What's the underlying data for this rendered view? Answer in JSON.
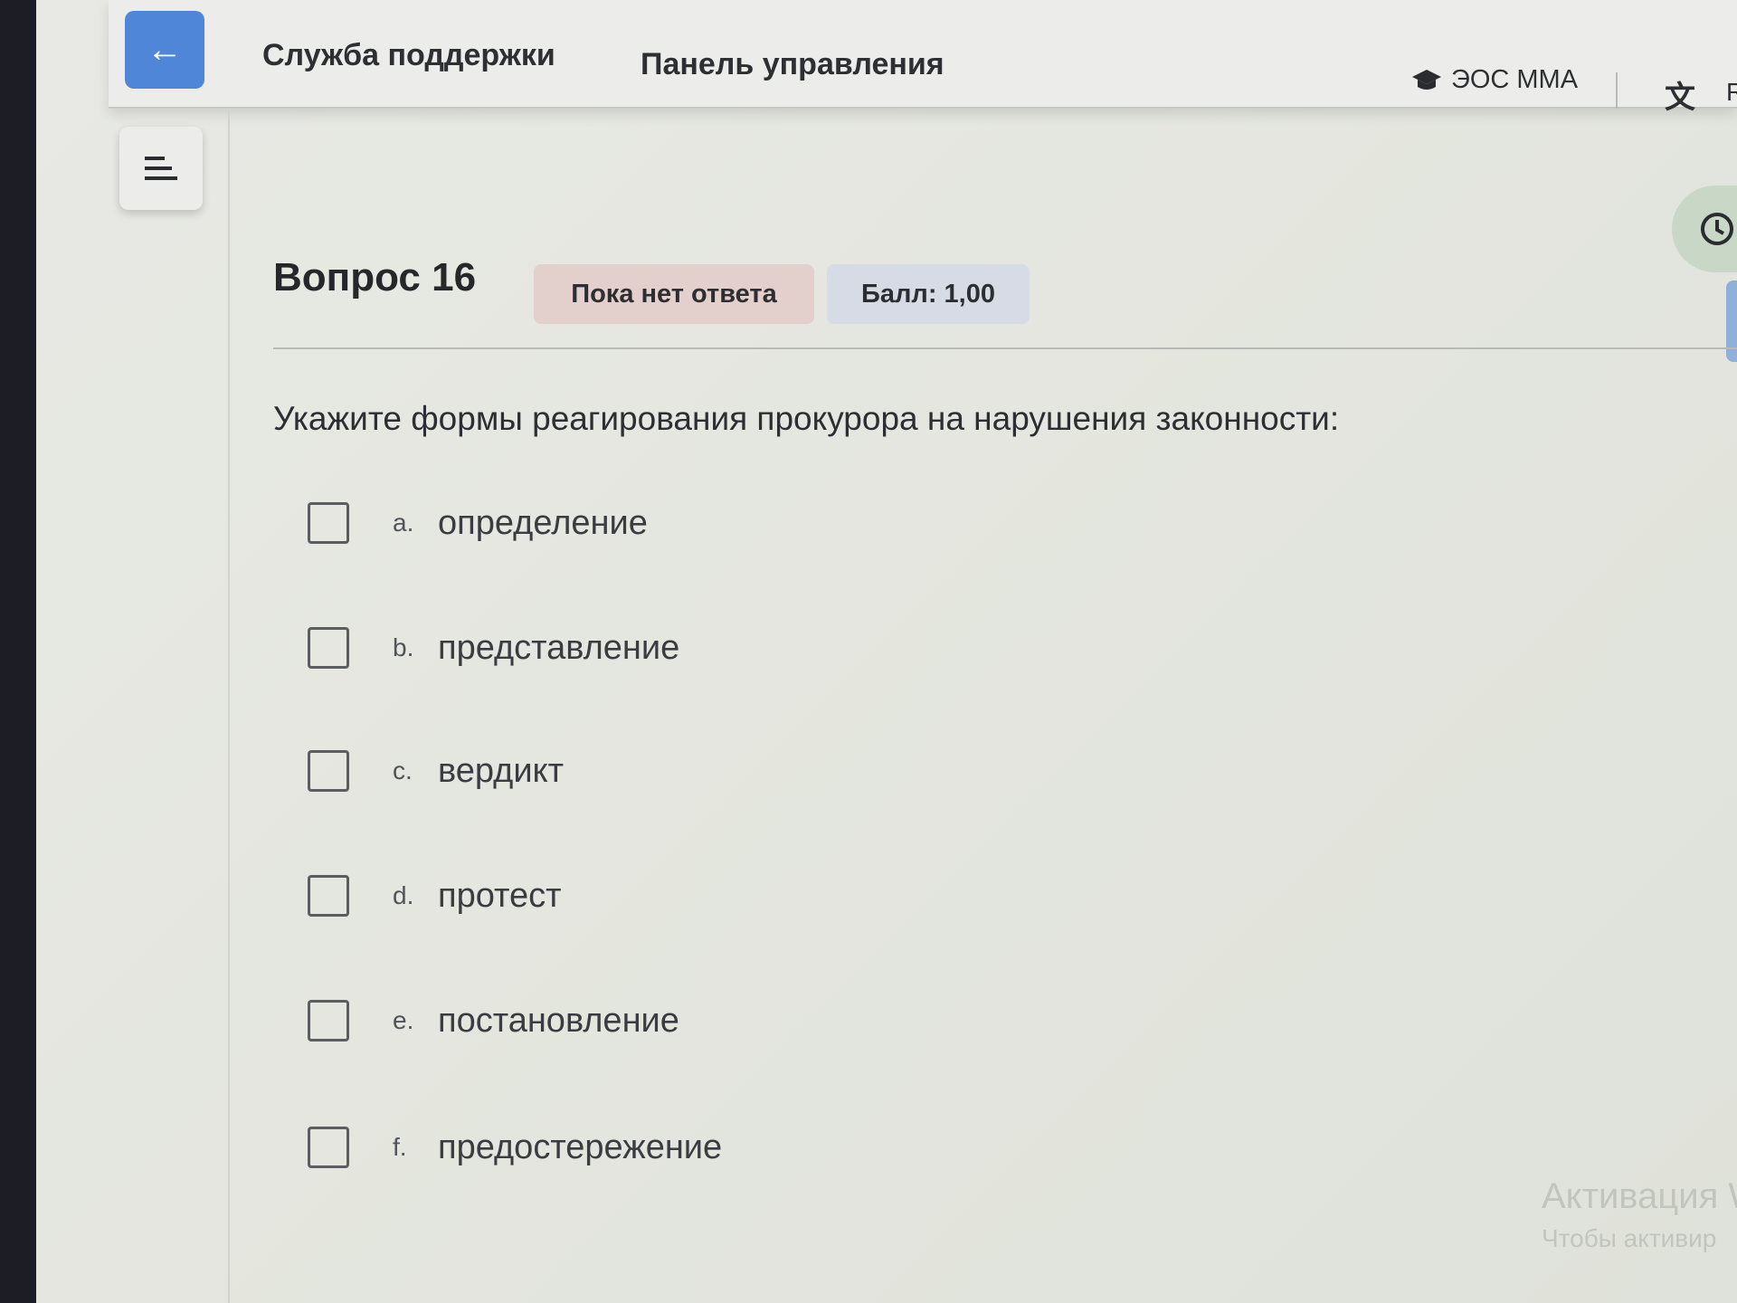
{
  "header": {
    "nav": [
      {
        "label": "Служба поддержки"
      },
      {
        "label": "Панель управления"
      }
    ],
    "site_name": "ЭОС ММА",
    "user_cut": "R",
    "translate_icon": "translate-icon"
  },
  "question": {
    "title": "Вопрос 16",
    "status": "Пока нет ответа",
    "score": "Балл: 1,00",
    "text": "Укажите формы реагирования прокурора на нарушения законности:",
    "options": [
      {
        "letter": "a.",
        "text": "определение",
        "checked": false
      },
      {
        "letter": "b.",
        "text": "представление",
        "checked": false
      },
      {
        "letter": "c.",
        "text": "вердикт",
        "checked": false
      },
      {
        "letter": "d.",
        "text": "протест",
        "checked": false
      },
      {
        "letter": "e.",
        "text": "постановление",
        "checked": false
      },
      {
        "letter": "f.",
        "text": "предостережение",
        "checked": false
      }
    ]
  },
  "watermark": {
    "title": "Активация W",
    "subtitle": "Чтобы активир"
  },
  "colors": {
    "accent": "#4f86d8",
    "status_badge": "#e3cfcc",
    "score_badge": "#d6dbe5"
  }
}
